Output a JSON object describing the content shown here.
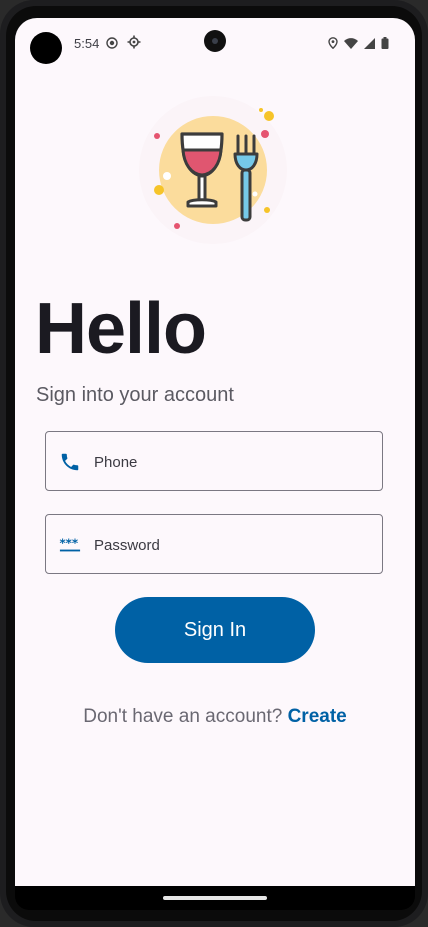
{
  "status_bar": {
    "time": "5:54"
  },
  "logo": {
    "icon": "wine-glass-and-fork-icon"
  },
  "heading": "Hello",
  "subtitle": "Sign into your account",
  "phone_field": {
    "placeholder": "Phone",
    "value": "",
    "icon": "phone-icon"
  },
  "password_field": {
    "placeholder": "Password",
    "value": "",
    "icon": "password-icon"
  },
  "signin_button": "Sign In",
  "signup": {
    "prompt": "Don't have an account?",
    "link": "Create"
  },
  "colors": {
    "primary": "#0061a5",
    "background": "#fdf8fc",
    "heading": "#1b1a21"
  }
}
